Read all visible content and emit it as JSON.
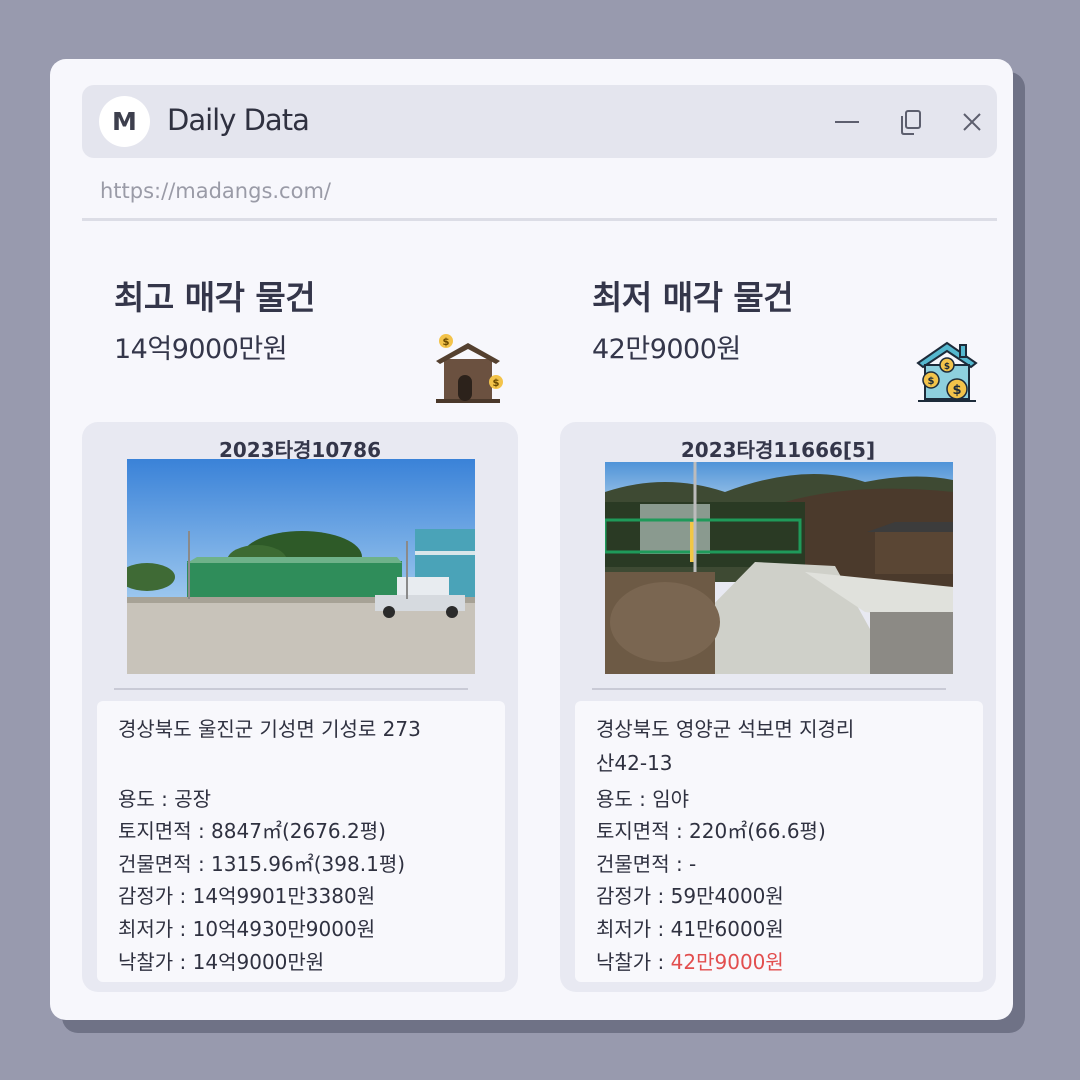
{
  "app": {
    "logo_letter": "M",
    "title": "Daily Data",
    "url": "https://madangs.com/"
  },
  "window_controls": {
    "icons": [
      "minimize-icon",
      "copy-icon",
      "close-icon"
    ]
  },
  "highest": {
    "heading": "최고 매각 물건",
    "price": "14억9000만원",
    "icon": "house-money-icon",
    "case_no": "2023타경10786",
    "address_line1": "경상북도 울진군 기성면 기성로 273",
    "address_line2": "",
    "usage": "용도 : 공장",
    "land_area": "토지면적 : 8847㎡(2676.2평)",
    "building_area": "건물면적 : 1315.96㎡(398.1평)",
    "appraisal": "감정가 : 14억9901만3380원",
    "minimum": "최저가 : 10억4930만9000원",
    "winning_label": "낙찰가 : ",
    "winning_value": "14억9000만원"
  },
  "lowest": {
    "heading": "최저 매각 물건",
    "price": "42만9000원",
    "icon": "house-coins-icon",
    "case_no": "2023타경11666[5]",
    "address_line1": "경상북도 영양군 석보면 지경리",
    "address_line2": "산42-13",
    "usage": "용도 :  임야",
    "land_area": "토지면적 : 220㎡(66.6평)",
    "building_area": "건물면적 : -",
    "appraisal": "감정가 : 59만4000원",
    "minimum": "최저가 : 41만6000원",
    "winning_label": "낙찰가 : ",
    "winning_value": "42만9000원"
  },
  "colors": {
    "background": "#989aae",
    "window": "#f7f7fc",
    "card": "#e8e9f2",
    "accent_red": "#e24e4e"
  }
}
